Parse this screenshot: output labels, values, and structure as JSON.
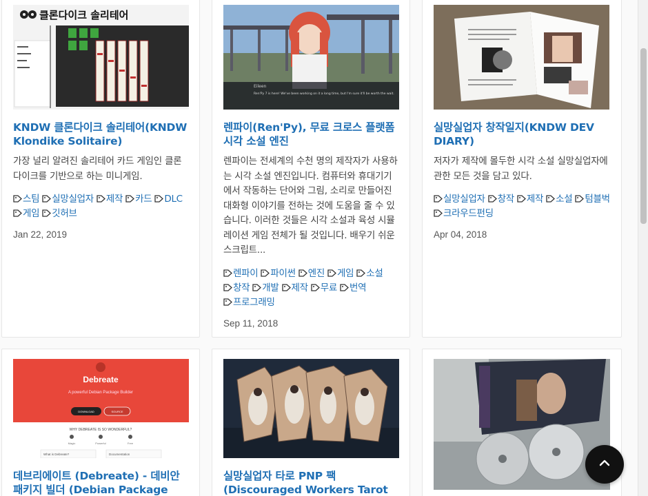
{
  "posts": [
    {
      "title": "KNDW 클론다이크 솔리테어(KNDW Klondike Solitaire)",
      "excerpt": "가장 널리 알려진 솔리테어 카드 게임인 클론다이크를 기반으로 하는 미니게임.",
      "tags": [
        "스팀",
        "실망실업자",
        "제작",
        "카드",
        "DLC",
        "게임",
        "깃허브"
      ],
      "date": "Jan 22, 2019",
      "thumb_caption": "클론다이크 솔리테어"
    },
    {
      "title": "렌파이(Ren'Py), 무료 크로스 플랫폼 시각 소설 엔진",
      "excerpt": "렌파이는 전세계의 수천 명의 제작자가 사용하는 시각 소설 엔진입니다. 컴퓨터와 휴대기기에서 작동하는 단어와 그림, 소리로 만들어진 대화형 이야기를 전하는 것에 도움을 줄 수 있습니다. 이러한 것들은 시각 소설과 육성 시뮬레이션 게임 전체가 될 것입니다. 배우기 쉬운 스크립트...",
      "tags": [
        "렌파이",
        "파이썬",
        "엔진",
        "게임",
        "소설",
        "창작",
        "개발",
        "제작",
        "무료",
        "번역",
        "프로그래밍"
      ],
      "date": "Sep 11, 2018",
      "thumb_speaker": "Eileen",
      "thumb_dialogue": "Ren'Py 7 is here! We've been working on it a long time, but I'm sure it'll be worth the wait."
    },
    {
      "title": "실망실업자 창작일지(KNDW DEV DIARY)",
      "excerpt": "저자가 제작에 몰두한 시각 소설 실망실업자에 관한 모든 것을 담고 있다.",
      "tags": [
        "실망실업자",
        "창작",
        "제작",
        "소설",
        "텀블벅",
        "크라우드펀딩"
      ],
      "date": "Apr 04, 2018"
    },
    {
      "title": "데브리에이트 (Debreate) - 데비안 패키지 빌더 (Debian Package",
      "thumb_brand": "Debreate",
      "thumb_tagline": "A powerful Debian Package Builder",
      "thumb_question": "WHY DEBREATE IS SO WONDERFUL?",
      "thumb_features": [
        "Magic",
        "Powerful",
        "Free"
      ],
      "thumb_left_label": "What is Debreate?",
      "thumb_right_label": "Documentation",
      "thumb_btn1": "DOWNLOAD",
      "thumb_btn2": "SOURCE"
    },
    {
      "title": "실망실업자 타로 PNP 팩 (Discouraged Workers Tarot PNP"
    },
    {
      "title": ""
    }
  ],
  "ui": {
    "back_to_top": "chevron-up-icon",
    "accent": "#1f6fb4",
    "tag_icon": "tag-icon"
  }
}
